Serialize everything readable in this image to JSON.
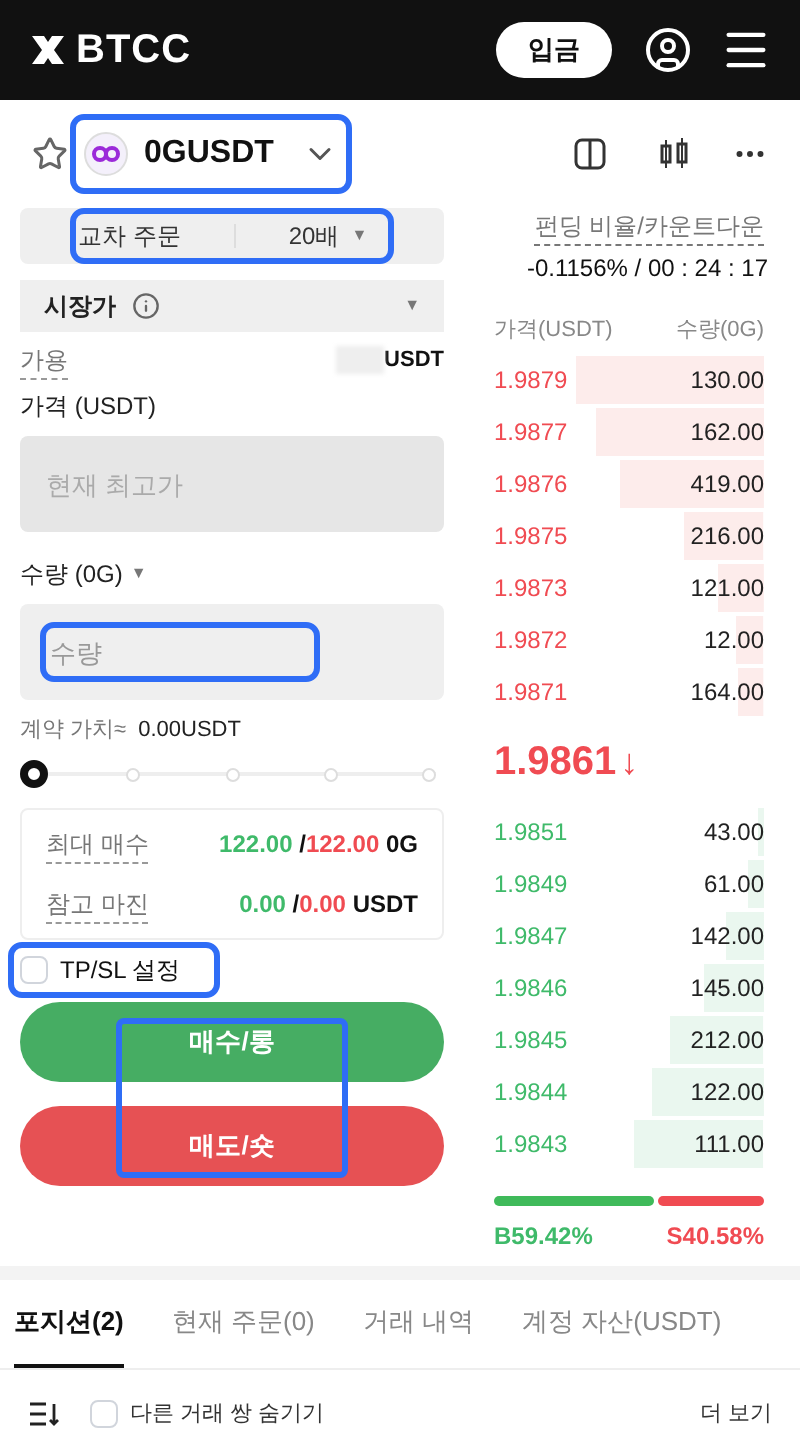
{
  "header": {
    "logo": "BTCC",
    "deposit_button": "입금"
  },
  "pair": {
    "symbol": "0GUSDT",
    "favorite": false,
    "highlighted": true
  },
  "funding": {
    "label": "펀딩 비율/카운트다운",
    "value": "-0.1156% / 00 : 24 : 17"
  },
  "margin": {
    "mode": "교차 주문",
    "leverage": "20배",
    "caret": "▼",
    "highlighted": true
  },
  "order_type": {
    "label": "시장가",
    "caret": "▼"
  },
  "available": {
    "label": "가용",
    "unit": "USDT"
  },
  "price": {
    "label": "가격 (USDT)",
    "placeholder": "현재 최고가"
  },
  "quantity": {
    "label": "수량 (0G)",
    "caret": "▼",
    "placeholder": "수량",
    "highlighted": true
  },
  "contract_value": {
    "label": "계약 가치≈",
    "value": "0.00USDT"
  },
  "slider": {
    "level": 0
  },
  "summary": [
    {
      "label": "최대 매수",
      "buy": "122.00",
      "sep": "/",
      "sell": "122.00",
      "unit": "0G"
    },
    {
      "label": "참고 마진",
      "buy": "0.00",
      "sep": "/",
      "sell": "0.00",
      "unit": "USDT"
    }
  ],
  "tpsl": {
    "label": "TP/SL 설정",
    "checked": false,
    "highlighted": true
  },
  "buttons": [
    {
      "label": "매수/롱",
      "kind": "buy"
    },
    {
      "label": "매도/숏",
      "kind": "sell"
    }
  ],
  "buttons_highlighted": true,
  "orderbook": {
    "price_header": "가격(USDT)",
    "qty_header": "수량(0G)",
    "asks": [
      {
        "price": "1.9879",
        "qty": "130.00"
      },
      {
        "price": "1.9877",
        "qty": "162.00"
      },
      {
        "price": "1.9876",
        "qty": "419.00"
      },
      {
        "price": "1.9875",
        "qty": "216.00"
      },
      {
        "price": "1.9873",
        "qty": "121.00"
      },
      {
        "price": "1.9872",
        "qty": "12.00"
      },
      {
        "price": "1.9871",
        "qty": "164.00"
      }
    ],
    "last_price": "1.9861",
    "last_arrow": "↓",
    "bids": [
      {
        "price": "1.9851",
        "qty": "43.00"
      },
      {
        "price": "1.9849",
        "qty": "61.00"
      },
      {
        "price": "1.9847",
        "qty": "142.00"
      },
      {
        "price": "1.9846",
        "qty": "145.00"
      },
      {
        "price": "1.9845",
        "qty": "212.00"
      },
      {
        "price": "1.9844",
        "qty": "122.00"
      },
      {
        "price": "1.9843",
        "qty": "111.00"
      }
    ],
    "ratio": {
      "level": 0.5942,
      "buy": "B59.42%",
      "sell": "S40.58%"
    }
  },
  "tabs": [
    {
      "label": "포지션(2)",
      "selected": true
    },
    {
      "label": "현재 주문(0)",
      "selected": false
    },
    {
      "label": "거래 내역",
      "selected": false
    },
    {
      "label": "계정 자산(USDT)",
      "selected": false
    }
  ],
  "filter": {
    "label": "다른 거래 쌍 숨기기",
    "checked": false,
    "more": "더 보기"
  }
}
